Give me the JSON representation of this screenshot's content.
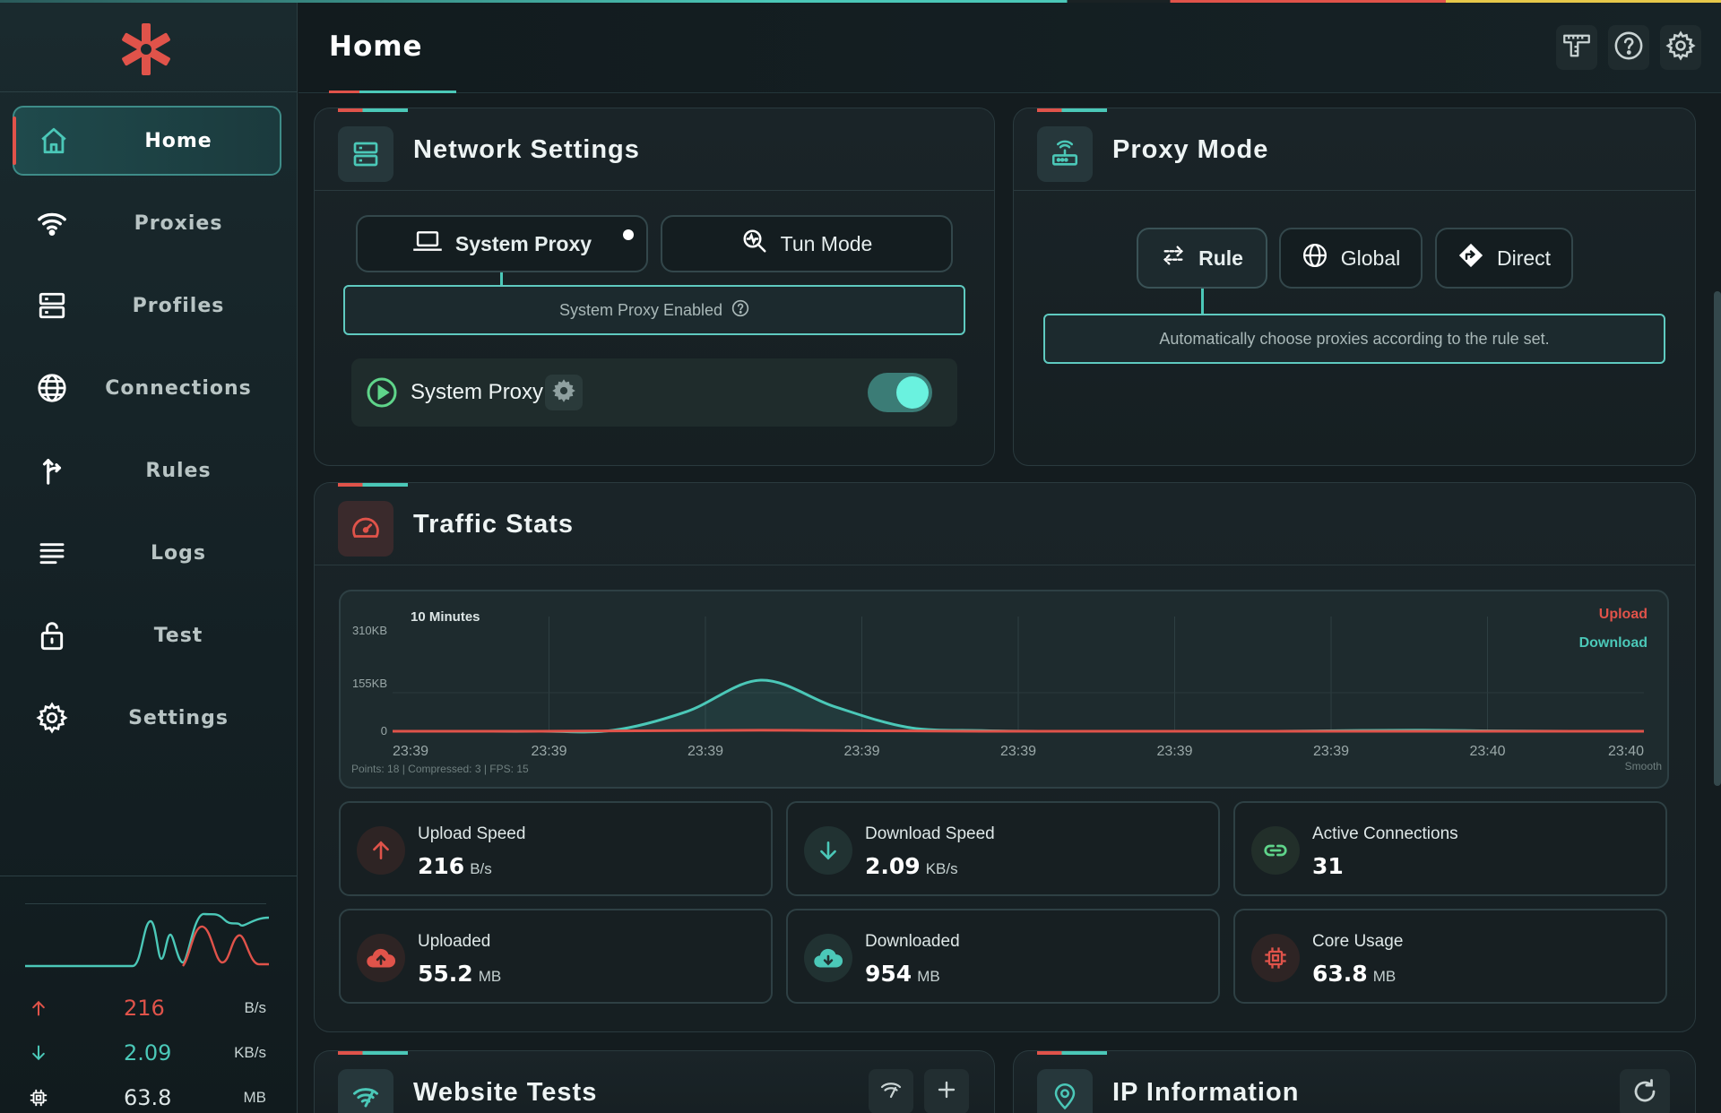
{
  "header": {
    "title": "Home"
  },
  "sidebar": {
    "items": [
      {
        "label": "Home",
        "icon": "home-icon",
        "active": true
      },
      {
        "label": "Proxies",
        "icon": "wifi-icon"
      },
      {
        "label": "Profiles",
        "icon": "server-icon"
      },
      {
        "label": "Connections",
        "icon": "globe-icon"
      },
      {
        "label": "Rules",
        "icon": "route-icon"
      },
      {
        "label": "Logs",
        "icon": "list-icon"
      },
      {
        "label": "Test",
        "icon": "lock-icon"
      },
      {
        "label": "Settings",
        "icon": "gear-icon"
      }
    ],
    "stats": {
      "upload_value": "216",
      "upload_unit": "B/s",
      "download_value": "2.09",
      "download_unit": "KB/s",
      "memory_value": "63.8",
      "memory_unit": "MB"
    }
  },
  "network_settings": {
    "title": "Network Settings",
    "tabs": [
      "System Proxy",
      "Tun Mode"
    ],
    "status": "System Proxy Enabled",
    "toggle_label": "System Proxy",
    "toggle_on": true
  },
  "proxy_mode": {
    "title": "Proxy Mode",
    "modes": [
      "Rule",
      "Global",
      "Direct"
    ],
    "selected": "Rule",
    "description": "Automatically choose proxies according to the rule set."
  },
  "traffic_stats": {
    "title": "Traffic Stats",
    "range_label": "10 Minutes",
    "legend_upload": "Upload",
    "legend_download": "Download",
    "y_ticks": [
      "310KB",
      "155KB",
      "0"
    ],
    "x_ticks": [
      "23:39",
      "23:39",
      "23:39",
      "23:39",
      "23:39",
      "23:39",
      "23:39",
      "23:40",
      "23:40"
    ],
    "footer_info": "Points: 18 | Compressed: 3 | FPS: 15",
    "footer_mode": "Smooth",
    "metrics": [
      {
        "label": "Upload Speed",
        "value": "216",
        "unit": "B/s"
      },
      {
        "label": "Download Speed",
        "value": "2.09",
        "unit": "KB/s"
      },
      {
        "label": "Active Connections",
        "value": "31",
        "unit": ""
      },
      {
        "label": "Uploaded",
        "value": "55.2",
        "unit": "MB"
      },
      {
        "label": "Downloaded",
        "value": "954",
        "unit": "MB"
      },
      {
        "label": "Core Usage",
        "value": "63.8",
        "unit": "MB"
      }
    ]
  },
  "website_tests": {
    "title": "Website Tests"
  },
  "ip_information": {
    "title": "IP Information"
  },
  "colors": {
    "accent_teal": "#4bc8b8",
    "accent_red": "#e0534a",
    "background": "#141c1f"
  },
  "chart_data": {
    "type": "area",
    "range": "10 Minutes",
    "x": [
      0,
      1,
      2,
      3,
      4,
      5,
      6,
      7,
      8,
      9,
      10,
      11,
      12,
      13,
      14,
      15,
      16,
      17
    ],
    "ylim": [
      0,
      310
    ],
    "y_unit": "KB",
    "series": [
      {
        "name": "Download",
        "values": [
          0,
          0,
          0,
          3,
          60,
          155,
          75,
          12,
          2,
          0,
          0,
          0,
          0,
          2,
          3,
          1,
          0,
          0
        ]
      },
      {
        "name": "Upload",
        "values": [
          0,
          0,
          0,
          1,
          2,
          3,
          2,
          1,
          0,
          0,
          0,
          0,
          0,
          0,
          0,
          0,
          0,
          0
        ]
      }
    ]
  }
}
